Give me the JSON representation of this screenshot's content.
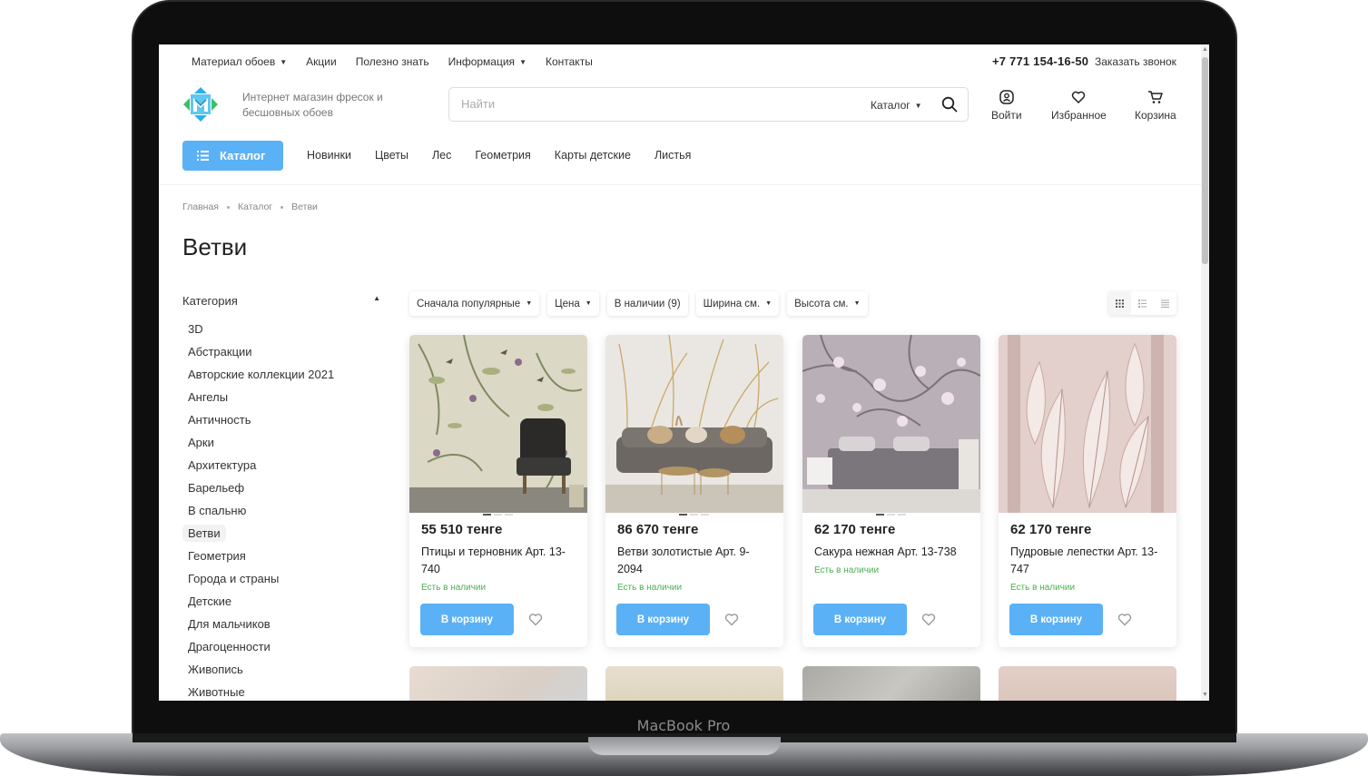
{
  "device": {
    "brand": "MacBook Pro"
  },
  "topbar": {
    "nav": [
      {
        "label": "Материал обоев",
        "dropdown": true
      },
      {
        "label": "Акции",
        "dropdown": false
      },
      {
        "label": "Полезно знать",
        "dropdown": false
      },
      {
        "label": "Информация",
        "dropdown": true
      },
      {
        "label": "Контакты",
        "dropdown": false
      }
    ],
    "phone": "+7 771 154-16-50",
    "callback": "Заказать звонок"
  },
  "header": {
    "tagline": "Интернет магазин фресок и бесшовных обоев",
    "search": {
      "placeholder": "Найти",
      "value": "",
      "scope": "Каталог"
    },
    "actions": {
      "login": "Войти",
      "favorites": "Избранное",
      "cart": "Корзина"
    }
  },
  "catalog_bar": {
    "button": "Каталог",
    "links": [
      "Новинки",
      "Цветы",
      "Лес",
      "Геометрия",
      "Карты детские",
      "Листья"
    ]
  },
  "breadcrumb": [
    "Главная",
    "Каталог",
    "Ветви"
  ],
  "page_title": "Ветви",
  "sidebar": {
    "heading": "Категория",
    "items": [
      "3D",
      "Абстракции",
      "Авторские коллекции 2021",
      "Ангелы",
      "Античность",
      "Арки",
      "Архитектура",
      "Барельеф",
      "В спальню",
      "Ветви",
      "Геометрия",
      "Города и страны",
      "Детские",
      "Для мальчиков",
      "Драгоценности",
      "Живопись",
      "Животные"
    ],
    "active": "Ветви"
  },
  "toolbar": {
    "sort": "Сначала популярные",
    "price": "Цена",
    "in_stock": "В наличии (9)",
    "width": "Ширина см.",
    "height": "Высота см."
  },
  "products": [
    {
      "price": "55 510 тенге",
      "name": "Птицы и терновник Арт. 13-740",
      "stock": "Есть в наличии",
      "buy": "В корзину"
    },
    {
      "price": "86 670 тенге",
      "name": "Ветви золотистые Арт. 9-2094",
      "stock": "Есть в наличии",
      "buy": "В корзину"
    },
    {
      "price": "62 170 тенге",
      "name": "Сакура нежная Арт. 13-738",
      "stock": "Есть в наличии",
      "buy": "В корзину"
    },
    {
      "price": "62 170 тенге",
      "name": "Пудровые лепестки Арт. 13-747",
      "stock": "Есть в наличии",
      "buy": "В корзину"
    }
  ],
  "colors": {
    "accent": "#5bb1f5",
    "stock_green": "#4caf50"
  }
}
